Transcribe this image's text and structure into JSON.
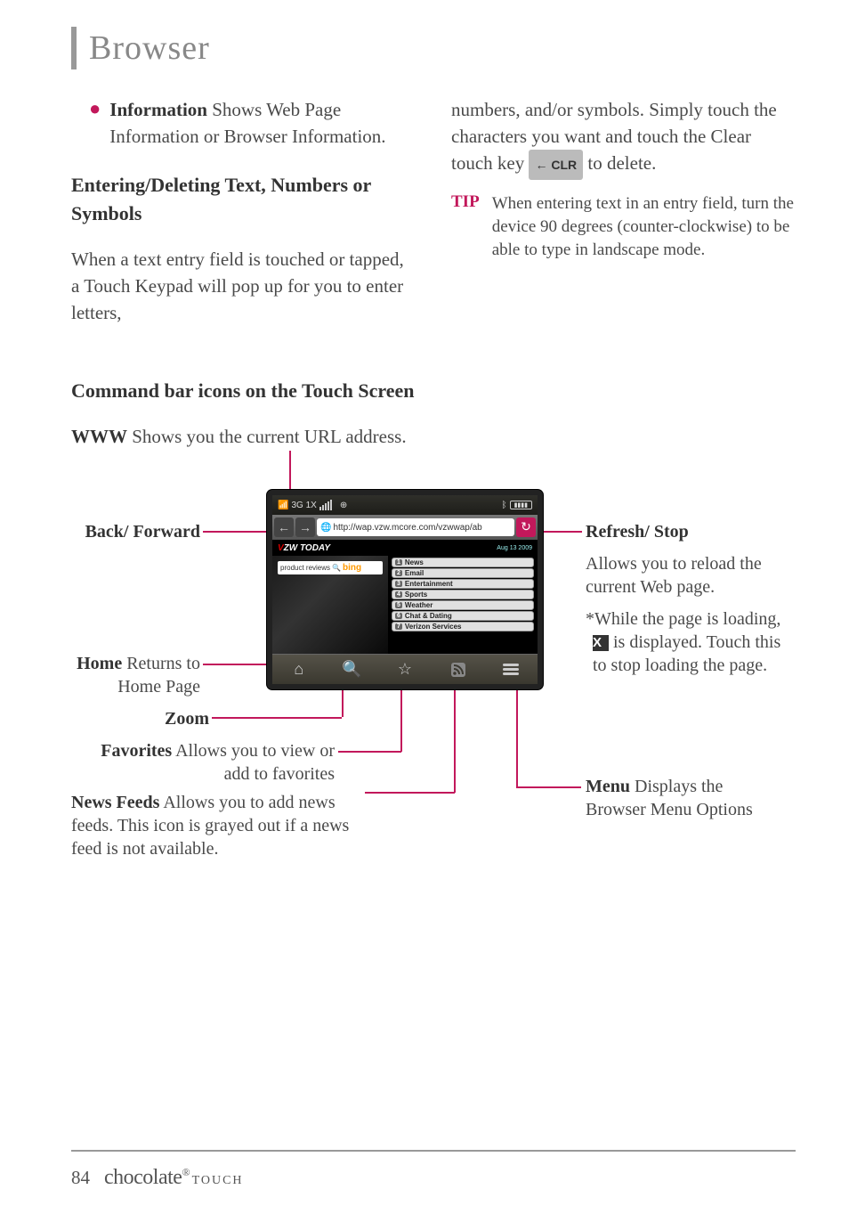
{
  "page": {
    "title": "Browser",
    "number": "84",
    "brand": "chocolate",
    "brand_suffix": "TOUCH",
    "reg": "®"
  },
  "col1": {
    "bullet_bold": "Information",
    "bullet_rest": " Shows Web Page Information or Browser Information.",
    "head": "Entering/Deleting Text, Numbers or Symbols",
    "para": "When a text entry field is touched or tapped, a Touch Keypad will pop up for you to enter letters,"
  },
  "col2": {
    "para_a": "numbers, and/or symbols. Simply touch the characters you want and touch the Clear touch key ",
    "clr": "← CLR",
    "para_b": " to delete.",
    "tip_label": "TIP",
    "tip_body": "When entering text in an entry field, turn the device 90 degrees (counter-clockwise) to be able to type in landscape mode."
  },
  "diagram": {
    "head": "Command bar icons on the Touch Screen",
    "www_bold": "WWW",
    "www_rest": " Shows you the current URL address.",
    "back_forward": "Back/ Forward",
    "home_bold": "Home",
    "home_rest": " Returns to Home Page",
    "zoom": "Zoom",
    "fav_bold": "Favorites",
    "fav_rest": " Allows you to view or add to favorites",
    "news_bold": "News Feeds",
    "news_rest": " Allows you to add news feeds. This icon is grayed out if a news feed is not available.",
    "refresh_head": "Refresh/ Stop",
    "refresh_body": "Allows you to reload the current Web page.",
    "stop_a": "*While the page is loading, ",
    "stop_x": "X",
    "stop_b": " is displayed. Touch this to stop loading the page.",
    "menu_bold": "Menu",
    "menu_rest": " Displays the Browser Menu Options"
  },
  "phone": {
    "status_left": "3G 1X",
    "url": "http://wap.vzw.mcore.com/vzwwap/ab",
    "vzw": "VZW TODAY",
    "date": "Aug 13 2009",
    "bing_prefix": "product reviews",
    "bing": "bing",
    "items": [
      "News",
      "Email",
      "Entertainment",
      "Sports",
      "Weather",
      "Chat & Dating",
      "Verizon Services"
    ]
  }
}
